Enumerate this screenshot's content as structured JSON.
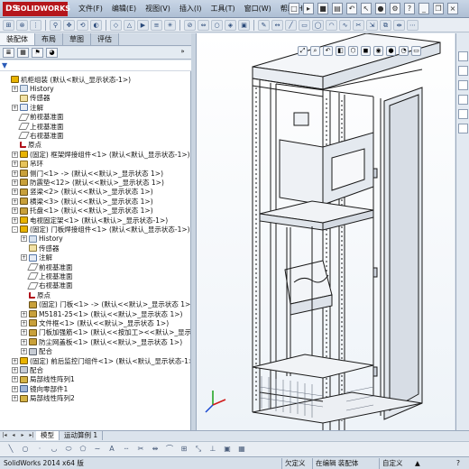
{
  "app": {
    "brand": "SOLIDWORKS",
    "brand_mark": "DS",
    "menus": [
      "文件(F)",
      "编辑(E)",
      "视图(V)",
      "插入(I)",
      "工具(T)",
      "窗口(W)",
      "帮助(H)"
    ]
  },
  "command_tabs": [
    "装配体",
    "布局",
    "草图",
    "评估"
  ],
  "tree": [
    {
      "level": 0,
      "exp": "",
      "icon": "asm",
      "label": "机柜组装 (默认<默认_显示状态-1>)"
    },
    {
      "level": 1,
      "exp": "+",
      "icon": "hist",
      "label": "History"
    },
    {
      "level": 1,
      "exp": "",
      "icon": "sens",
      "label": "传感器"
    },
    {
      "level": 1,
      "exp": "+",
      "icon": "note",
      "label": "注解"
    },
    {
      "level": 1,
      "exp": "",
      "icon": "plane",
      "label": "前视基准面"
    },
    {
      "level": 1,
      "exp": "",
      "icon": "plane",
      "label": "上视基准面"
    },
    {
      "level": 1,
      "exp": "",
      "icon": "plane",
      "label": "右视基准面"
    },
    {
      "level": 1,
      "exp": "",
      "icon": "origin",
      "label": "原点"
    },
    {
      "level": 1,
      "exp": "+",
      "icon": "asm",
      "label": "(固定) 框架焊接组件<1> (默认<默认_显示状态-1>)"
    },
    {
      "level": 1,
      "exp": "+",
      "icon": "folder",
      "label": "吊环"
    },
    {
      "level": 1,
      "exp": "+",
      "icon": "part",
      "label": "侧门<1> -> (默认<<默认>_显示状态 1>)"
    },
    {
      "level": 1,
      "exp": "+",
      "icon": "part",
      "label": "防震垫<12> (默认<<默认>_显示状态 1>)"
    },
    {
      "level": 1,
      "exp": "+",
      "icon": "part",
      "label": "竖梁<2> (默认<<默认>_显示状态 1>)"
    },
    {
      "level": 1,
      "exp": "+",
      "icon": "part",
      "label": "横梁<3> (默认<<默认>_显示状态 1>)"
    },
    {
      "level": 1,
      "exp": "+",
      "icon": "part",
      "label": "托盘<1> (默认<<默认>_显示状态 1>)"
    },
    {
      "level": 1,
      "exp": "+",
      "icon": "asm",
      "label": "电视固定架<1> (默认<默认>_显示状态-1>)"
    },
    {
      "level": 1,
      "exp": "-",
      "icon": "asm",
      "label": "(固定) 门板焊接组件<1> (默认<默认_显示状态-1>)"
    },
    {
      "level": 2,
      "exp": "+",
      "icon": "hist",
      "label": "History"
    },
    {
      "level": 2,
      "exp": "",
      "icon": "sens",
      "label": "传感器"
    },
    {
      "level": 2,
      "exp": "+",
      "icon": "note",
      "label": "注解"
    },
    {
      "level": 2,
      "exp": "",
      "icon": "plane",
      "label": "前视基准面"
    },
    {
      "level": 2,
      "exp": "",
      "icon": "plane",
      "label": "上视基准面"
    },
    {
      "level": 2,
      "exp": "",
      "icon": "plane",
      "label": "右视基准面"
    },
    {
      "level": 2,
      "exp": "",
      "icon": "origin",
      "label": "原点"
    },
    {
      "level": 2,
      "exp": "",
      "icon": "part",
      "label": "(固定) 门板<1> -> (默认<<默认>_显示状态 1>)"
    },
    {
      "level": 2,
      "exp": "+",
      "icon": "part",
      "label": "M5181-25<1> (默认<<默认>_显示状态 1>)"
    },
    {
      "level": 2,
      "exp": "+",
      "icon": "part",
      "label": "文件框<1> (默认<<默认>_显示状态 1>)"
    },
    {
      "level": 2,
      "exp": "+",
      "icon": "part",
      "label": "门板加强筋<1> (默认<<按加工><<默认>_显示状态 1>)"
    },
    {
      "level": 2,
      "exp": "+",
      "icon": "part",
      "label": "防尘网盖板<1> (默认<<默认>_显示状态 1>)"
    },
    {
      "level": 2,
      "exp": "+",
      "icon": "mate",
      "label": "配合"
    },
    {
      "level": 1,
      "exp": "+",
      "icon": "asm",
      "label": "(固定) 前后监控门组件<1> (默认<默认_显示状态-1>)"
    },
    {
      "level": 1,
      "exp": "+",
      "icon": "mate",
      "label": "配合"
    },
    {
      "level": 1,
      "exp": "+",
      "icon": "pattern",
      "label": "局部线性阵列1"
    },
    {
      "level": 1,
      "exp": "+",
      "icon": "mirror",
      "label": "镜向零部件1"
    },
    {
      "level": 1,
      "exp": "+",
      "icon": "pattern",
      "label": "局部线性阵列2"
    }
  ],
  "bottom_tabs": [
    "模型",
    "运动算例 1"
  ],
  "status": {
    "app_version": "SolidWorks 2014 x64 版",
    "left": "欠定义",
    "mid": "在编辑 装配体",
    "right": "自定义",
    "help": "?"
  },
  "colors": {
    "accent": "#b5161b",
    "frame": "#1a1a1a",
    "panel_bg": "#dfe6ee"
  }
}
